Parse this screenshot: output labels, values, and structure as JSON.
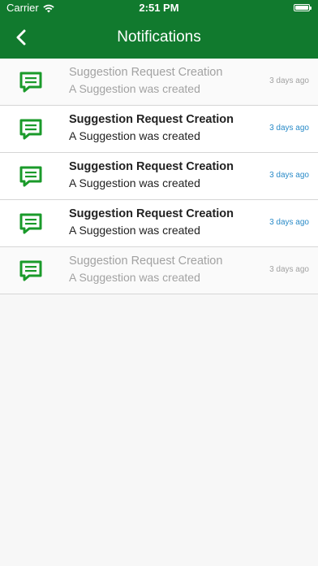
{
  "status_bar": {
    "carrier": "Carrier",
    "time": "2:51 PM"
  },
  "nav": {
    "title": "Notifications",
    "back_icon": "chevron-left-icon"
  },
  "colors": {
    "header": "#117a2e",
    "icon": "#1a9a2a",
    "unread_time": "#2a8bc8",
    "read_text": "#a2a2a2"
  },
  "notifications": [
    {
      "title": "Suggestion Request Creation",
      "subtitle": "A Suggestion was created",
      "time": "3 days ago",
      "read": true
    },
    {
      "title": "Suggestion Request Creation",
      "subtitle": "A Suggestion was created",
      "time": "3 days ago",
      "read": false
    },
    {
      "title": "Suggestion Request Creation",
      "subtitle": "A Suggestion was created",
      "time": "3 days ago",
      "read": false
    },
    {
      "title": "Suggestion Request Creation",
      "subtitle": "A Suggestion was created",
      "time": "3 days ago",
      "read": false
    },
    {
      "title": "Suggestion Request Creation",
      "subtitle": "A Suggestion was created",
      "time": "3 days ago",
      "read": true
    }
  ]
}
